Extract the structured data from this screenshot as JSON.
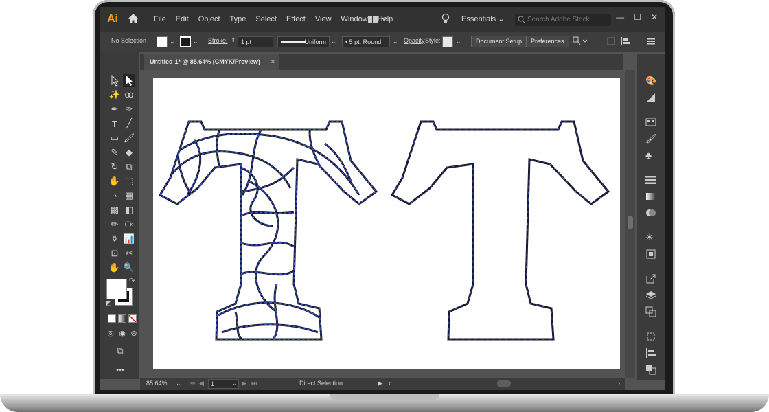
{
  "app": {
    "logo": "Ai"
  },
  "menu": [
    "File",
    "Edit",
    "Object",
    "Type",
    "Select",
    "Effect",
    "View",
    "Window",
    "Help"
  ],
  "workspace": {
    "label": "Essentials"
  },
  "search": {
    "placeholder": "Search Adobe Stock"
  },
  "window_controls": {
    "minimize": "—",
    "maximize": "☐",
    "close": "✕"
  },
  "control_bar": {
    "selection": "No Selection",
    "stroke_label": "Stroke:",
    "stroke_weight": "1 pt",
    "profile": "Uniform",
    "brush": "5 pt. Round",
    "opacity_label": "Opacity",
    "style_label": "Style:",
    "document_setup": "Document Setup",
    "preferences": "Preferences"
  },
  "document_tab": {
    "title": "Untitled-1* @ 85.64% (CMYK/Preview)",
    "close": "×"
  },
  "status": {
    "zoom": "85.64%",
    "artboard": "1",
    "tool": "Direct Selection"
  },
  "tools_more": "•••",
  "colors": {
    "ui_dark": "#323232",
    "panel": "#3b3b3b",
    "canvas_bg": "#535353",
    "path_blue": "#3b5bdb",
    "outline_dark": "#1a1a2e",
    "logo_orange": "#ff9a00"
  },
  "icons": {
    "home": "home-icon",
    "bulb": "lightbulb-icon",
    "search": "search-icon",
    "direct_selection": "direct-selection-icon"
  }
}
